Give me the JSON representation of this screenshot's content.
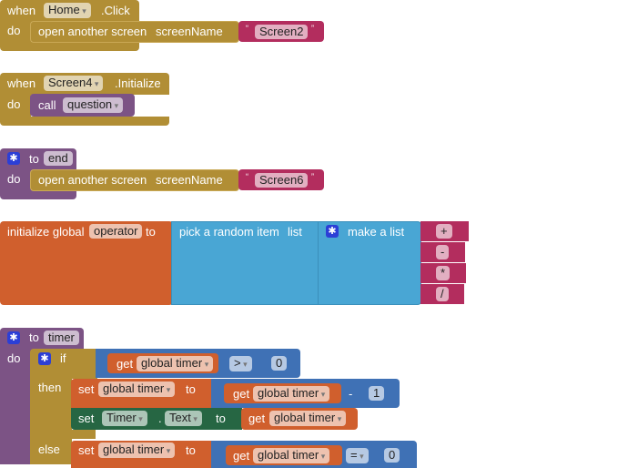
{
  "blocks": {
    "home_click": {
      "when": "when",
      "component": "Home",
      "event": ".Click",
      "do": "do",
      "action": "open another screen",
      "param": "screenName",
      "value": "Screen2"
    },
    "screen4_init": {
      "when": "when",
      "component": "Screen4",
      "event": ".Initialize",
      "do": "do",
      "call": "call",
      "procedure": "question"
    },
    "proc_end": {
      "to": "to",
      "name": "end",
      "do": "do",
      "action": "open another screen",
      "param": "screenName",
      "value": "Screen6"
    },
    "init_operator": {
      "label": "initialize global",
      "name": "operator",
      "to": "to",
      "pick": "pick a random item",
      "list": "list",
      "make_list": "make a list",
      "items": [
        "+",
        "-",
        "*",
        "/"
      ]
    },
    "proc_timer": {
      "to": "to",
      "name": "timer",
      "do": "do",
      "if": "if",
      "then": "then",
      "else": "else",
      "get": "get",
      "set": "set",
      "var": "global timer",
      "cond_op": ">",
      "cond_value": "0",
      "minus_op": "-",
      "minus_value": "1",
      "component": "Timer",
      "dot": ".",
      "property": "Text",
      "else_op": "=",
      "else_value": "0"
    }
  },
  "quote_open": "“",
  "quote_close": "”",
  "colors": {
    "event": "#B18E35",
    "text": "#B32D5E",
    "procedure": "#7C5385",
    "variable": "#D05F2D",
    "list": "#49A6D4",
    "math": "#3F71B5",
    "component": "#266643"
  }
}
